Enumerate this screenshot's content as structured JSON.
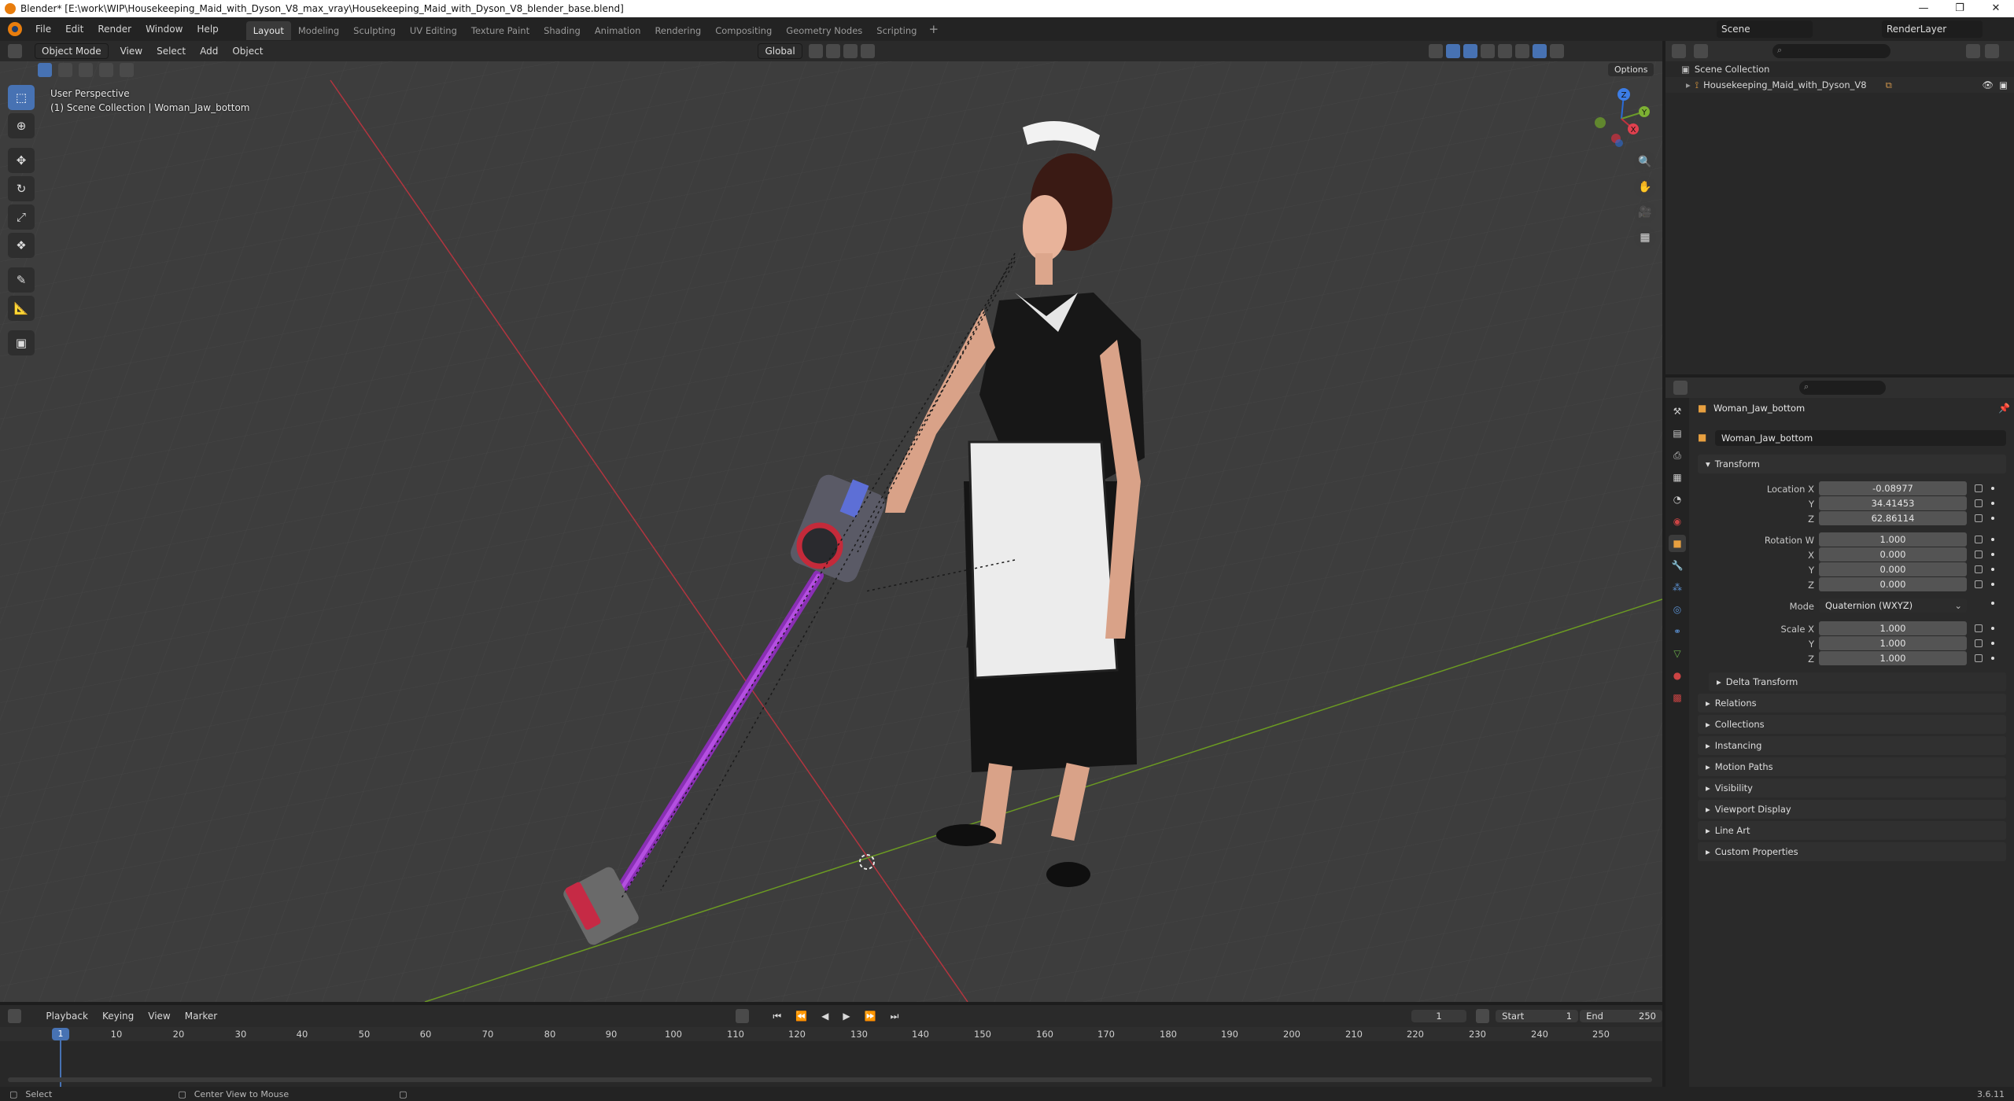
{
  "window": {
    "title": "Blender* [E:\\work\\WIP\\Housekeeping_Maid_with_Dyson_V8_max_vray\\Housekeeping_Maid_with_Dyson_V8_blender_base.blend]",
    "controls": [
      "—",
      "❐",
      "✕"
    ]
  },
  "menu": [
    "File",
    "Edit",
    "Render",
    "Window",
    "Help"
  ],
  "workspaces": [
    "Layout",
    "Modeling",
    "Sculpting",
    "UV Editing",
    "Texture Paint",
    "Shading",
    "Animation",
    "Rendering",
    "Compositing",
    "Geometry Nodes",
    "Scripting"
  ],
  "active_workspace": "Layout",
  "scene": {
    "name": "Scene",
    "view_layer": "RenderLayer"
  },
  "viewport": {
    "mode": "Object Mode",
    "menus": [
      "View",
      "Select",
      "Add",
      "Object"
    ],
    "orientation": "Global",
    "options_label": "Options",
    "perspective": "User Perspective",
    "context": "(1) Scene Collection | Woman_Jaw_bottom",
    "gizmo": {
      "z": "Z",
      "y": "Y",
      "x": "X"
    }
  },
  "tools": [
    "select-box",
    "cursor",
    "move",
    "rotate",
    "scale",
    "transform",
    "annotate",
    "measure",
    "add-cube"
  ],
  "timeline": {
    "menus": [
      "Playback",
      "Keying",
      "View",
      "Marker"
    ],
    "current_frame": "1",
    "start_label": "Start",
    "start": "1",
    "end_label": "End",
    "end": "250",
    "ruler": [
      "10",
      "20",
      "30",
      "40",
      "50",
      "60",
      "70",
      "80",
      "90",
      "100",
      "110",
      "120",
      "130",
      "140",
      "150",
      "160",
      "170",
      "180",
      "190",
      "200",
      "210",
      "220",
      "230",
      "240",
      "250"
    ],
    "playhead_label": "1"
  },
  "status": {
    "left": "Select",
    "middle": "Center View to Mouse",
    "version": "3.6.11"
  },
  "outliner": {
    "root": "Scene Collection",
    "items": [
      {
        "name": "Housekeeping_Maid_with_Dyson_V8"
      }
    ]
  },
  "properties": {
    "object_name": "Woman_Jaw_bottom",
    "data_name": "Woman_Jaw_bottom",
    "transform_label": "Transform",
    "location": {
      "label": "Location X",
      "x": "-0.08977",
      "y": "34.41453",
      "z": "62.86114"
    },
    "rotation": {
      "label": "Rotation W",
      "w": "1.000",
      "x": "0.000",
      "y": "0.000",
      "z": "0.000"
    },
    "mode_label": "Mode",
    "mode": "Quaternion (WXYZ)",
    "scale": {
      "label": "Scale X",
      "x": "1.000",
      "y": "1.000",
      "z": "1.000"
    },
    "axis_labels": {
      "x": "X",
      "y": "Y",
      "z": "Z"
    },
    "delta": "Delta Transform",
    "panels": [
      "Relations",
      "Collections",
      "Instancing",
      "Motion Paths",
      "Visibility",
      "Viewport Display",
      "Line Art",
      "Custom Properties"
    ]
  }
}
